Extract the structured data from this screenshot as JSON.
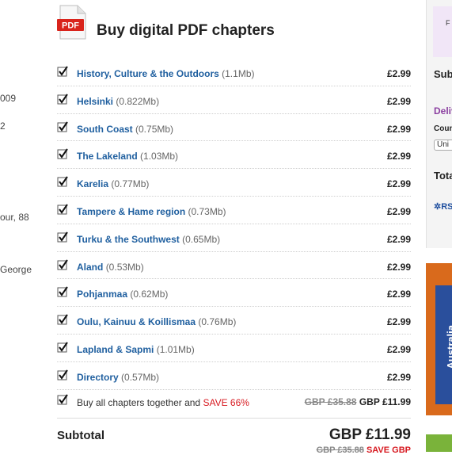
{
  "left_fragments": [
    "009",
    "2",
    "our, 88",
    "George"
  ],
  "header": {
    "title": "Buy digital PDF chapters",
    "pdf_icon_label": "PDF"
  },
  "chapters": [
    {
      "name": "History, Culture & the Outdoors",
      "size": "(1.1Mb)",
      "price": "£2.99",
      "checked": true
    },
    {
      "name": "Helsinki",
      "size": "(0.822Mb)",
      "price": "£2.99",
      "checked": true
    },
    {
      "name": "South Coast",
      "size": "(0.75Mb)",
      "price": "£2.99",
      "checked": true
    },
    {
      "name": "The Lakeland",
      "size": "(1.03Mb)",
      "price": "£2.99",
      "checked": true
    },
    {
      "name": "Karelia",
      "size": "(0.77Mb)",
      "price": "£2.99",
      "checked": true
    },
    {
      "name": "Tampere & Hame region",
      "size": "(0.73Mb)",
      "price": "£2.99",
      "checked": true
    },
    {
      "name": "Turku & the Southwest",
      "size": "(0.65Mb)",
      "price": "£2.99",
      "checked": true
    },
    {
      "name": "Aland",
      "size": "(0.53Mb)",
      "price": "£2.99",
      "checked": true
    },
    {
      "name": "Pohjanmaa",
      "size": "(0.62Mb)",
      "price": "£2.99",
      "checked": true
    },
    {
      "name": "Oulu, Kainuu & Koillismaa",
      "size": "(0.76Mb)",
      "price": "£2.99",
      "checked": true
    },
    {
      "name": "Lapland & Sapmi",
      "size": "(1.01Mb)",
      "price": "£2.99",
      "checked": true
    },
    {
      "name": "Directory",
      "size": "(0.57Mb)",
      "price": "£2.99",
      "checked": true
    }
  ],
  "buy_all": {
    "text": "Buy all chapters together and",
    "save_text": "SAVE 66%",
    "old_price": "GBP £35.88",
    "new_price": "GBP £11.99",
    "checked": true
  },
  "subtotal": {
    "label": "Subtotal",
    "amount": "GBP £11.99",
    "old_price": "GBP £35.88",
    "save_text": "SAVE GBP"
  },
  "sidebar": {
    "box_text": "F",
    "subtotal_label": "Sub",
    "delivery_label": "Deliv",
    "country_label": "Coun",
    "country_select": "Uni",
    "total_label": "Tota",
    "rss_label": "RS",
    "book_title": "Australia"
  },
  "colors": {
    "link": "#1f5f9f",
    "save": "#d71920",
    "book_bg": "#d96a1c",
    "pdf_red": "#d9241c"
  }
}
